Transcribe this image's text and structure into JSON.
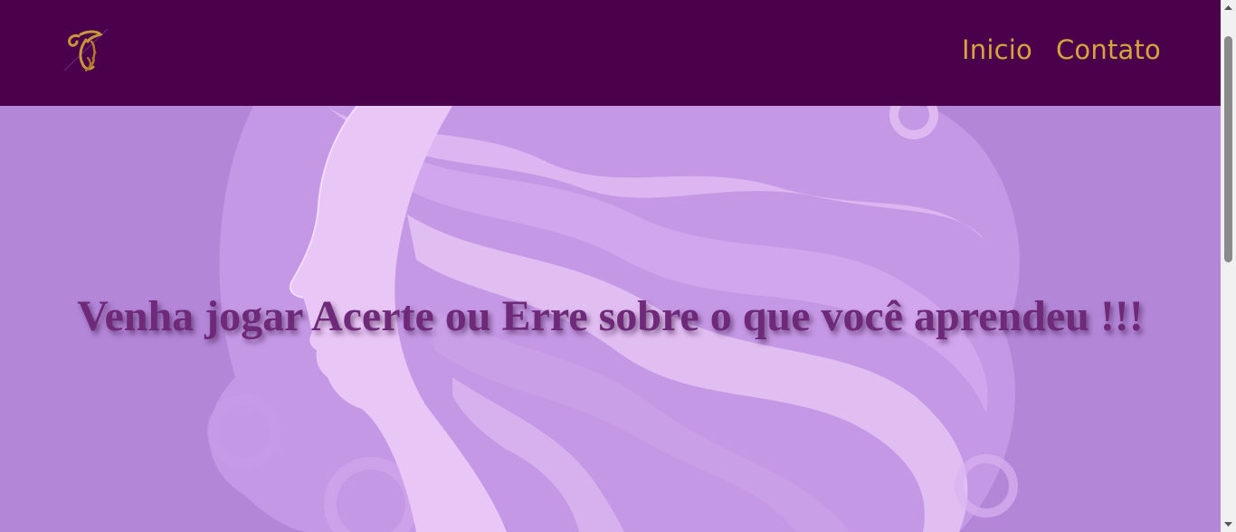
{
  "navbar": {
    "logo_icon": "woman-silhouette-logo-icon",
    "links": [
      {
        "label": "Inicio"
      },
      {
        "label": "Contato"
      }
    ]
  },
  "hero": {
    "background_image": "purple-woman-flowing-hair-illustration",
    "title": "Venha jogar Acerte ou Erre sobre o que você aprendeu !!!"
  },
  "colors": {
    "navbar_bg": "#4b004b",
    "nav_link": "#d4a53a",
    "hero_bg": "#b386d8",
    "title_text": "#6e2a78"
  },
  "icons": {
    "scroll_up": "scroll-up-arrow-icon",
    "scroll_down": "scroll-down-arrow-icon"
  }
}
